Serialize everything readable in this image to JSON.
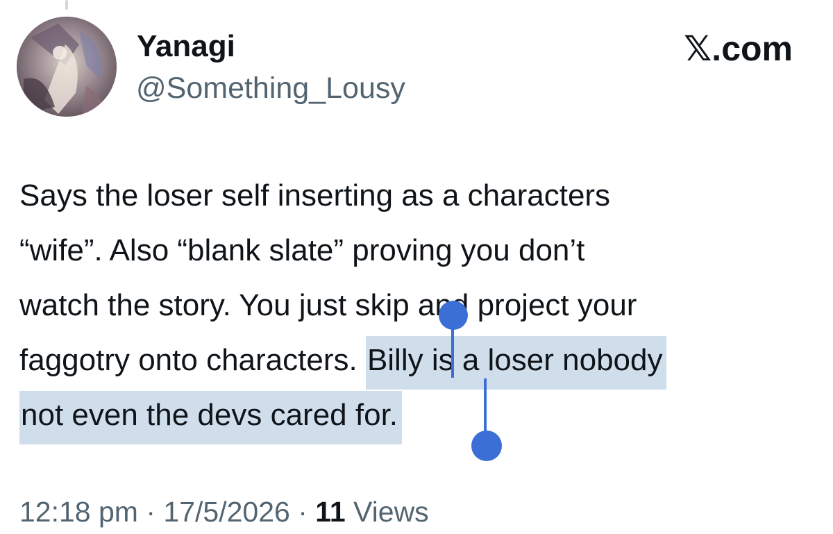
{
  "author": {
    "display_name": "Yanagi",
    "handle": "@Something_Lousy",
    "avatar_icon": "profile-avatar-anime-art"
  },
  "brand": {
    "label": "𝕏.com"
  },
  "tweet": {
    "lines": [
      "Says the loser self inserting as a characters",
      "“wife”. Also “blank slate” proving you don’t",
      "watch the story. You just skip and project your",
      "faggotry onto characters. "
    ],
    "selected_part1": "Billy is a loser nobody",
    "selected_part2": "not even the devs cared for.",
    "selection_color": "#d0deec",
    "selection_handle_color": "#3b6fd6"
  },
  "meta": {
    "time": "12:18 pm",
    "separator": "·",
    "date": "17/5/2026",
    "views_count": "11",
    "views_label": "Views"
  }
}
